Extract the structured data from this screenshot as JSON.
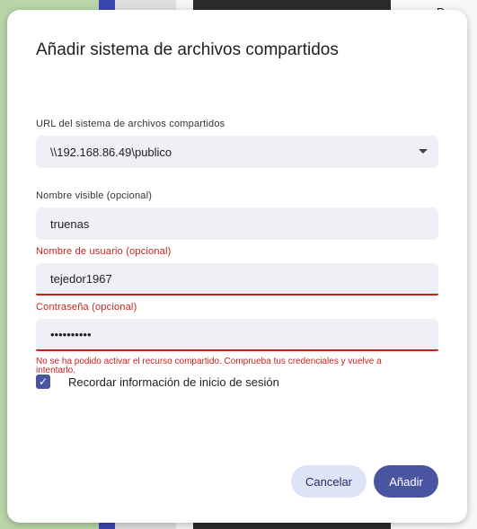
{
  "background": {
    "right_label": "Pap"
  },
  "dialog": {
    "title": "Añadir sistema de archivos compartidos",
    "url": {
      "label": "URL del sistema de archivos compartidos",
      "value": "\\\\192.168.86.49\\publico"
    },
    "display_name": {
      "label": "Nombre visible (opcional)",
      "value": "truenas"
    },
    "username": {
      "label": "Nombre de usuario (opcional)",
      "value": "tejedor1967"
    },
    "password": {
      "label": "Contraseña (opcional)",
      "value": "••••••••••"
    },
    "error_message": "No se ha podido activar el recurso compartido. Comprueba tus credenciales y vuelve a intentarlo.",
    "remember": {
      "label": "Recordar información de inicio de sesión",
      "checked": true
    },
    "buttons": {
      "cancel": "Cancelar",
      "add": "Añadir"
    }
  },
  "colors": {
    "accent": "#4a55a2",
    "error": "#c5221f",
    "field_bg": "#eef0f5"
  }
}
